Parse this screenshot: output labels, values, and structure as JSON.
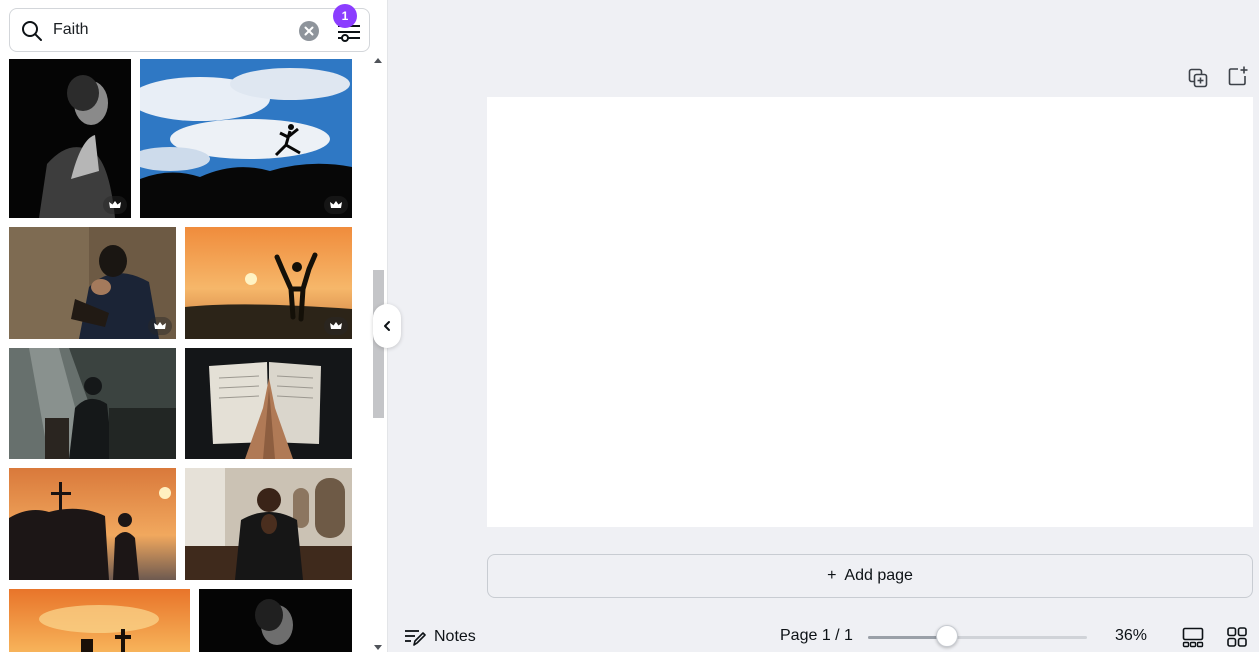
{
  "search": {
    "value": "Faith",
    "filter_count": "1"
  },
  "results": {
    "images": [
      {
        "subject": "woman praying in dark",
        "premium": true
      },
      {
        "subject": "person jumping against cloudy sky",
        "premium": true
      },
      {
        "subject": "man praying with hands together",
        "premium": true
      },
      {
        "subject": "silhouette arms raised at sunset",
        "premium": true
      },
      {
        "subject": "man praying in sunlit church",
        "premium": false
      },
      {
        "subject": "hands praying over open bible",
        "premium": false
      },
      {
        "subject": "people with cross at sunset",
        "premium": false
      },
      {
        "subject": "man praying in church pew",
        "premium": false
      },
      {
        "subject": "cross and lantern at orange sunset",
        "premium": false
      },
      {
        "subject": "woman looking up in dark",
        "premium": false
      }
    ]
  },
  "canvas": {
    "add_page_label": "Add page",
    "add_page_icon": "plus-icon"
  },
  "toolbar": {
    "duplicate_icon": "duplicate-page-icon",
    "add_icon": "add-page-icon"
  },
  "footer": {
    "notes_label": "Notes",
    "page_indicator": "Page 1 / 1",
    "zoom_label": "36%",
    "zoom_level": 0.36
  },
  "colors": {
    "accent": "#8b3dff",
    "background": "#eff0f4",
    "canvas": "#ffffff"
  }
}
